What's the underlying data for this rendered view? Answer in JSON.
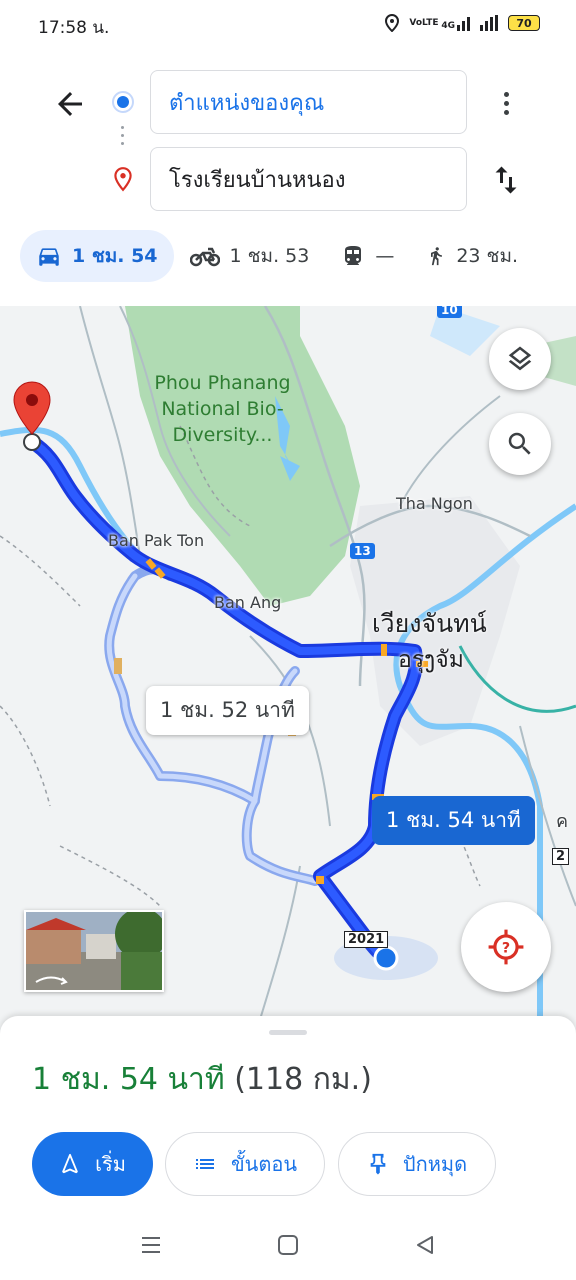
{
  "status_bar": {
    "time": "17:58 น.",
    "network": "4G",
    "volte": "VoLTE",
    "battery": "70"
  },
  "header": {
    "origin": "ตำแหน่งของคุณ",
    "destination": "โรงเรียนบ้านหนอง",
    "icons": {
      "back": "arrow-back-icon",
      "more": "more-vert-icon",
      "swap": "swap-vert-icon"
    }
  },
  "modes": [
    {
      "icon": "car-icon",
      "label": "1 ชม. 54",
      "active": true
    },
    {
      "icon": "motorcycle-icon",
      "label": "1 ชม. 53",
      "active": false
    },
    {
      "icon": "transit-icon",
      "label": "—",
      "active": false
    },
    {
      "icon": "walk-icon",
      "label": "23 ชม.",
      "active": false
    }
  ],
  "map": {
    "labels": {
      "park": "Phou Phanang National Bio-Diversity...",
      "tha_ngon": "Tha Ngon",
      "ban_pak_ton": "Ban Pak Ton",
      "ban_ang": "Ban Ang",
      "city": "เวียงจันทน์",
      "city_sub": "อรุງจัม",
      "route_13": "13",
      "route_2": "2",
      "route_2021": "2021",
      "route_top": "10",
      "edge_char": "ค"
    },
    "alt_route_time": "1 ชม. 52 นาที",
    "main_route_time": "1 ชม. 54 นาที",
    "colors": {
      "route": "#1a4dff",
      "alt_route": "#a8c0f5",
      "park": "#a5d6a7",
      "water": "#7fc8f8"
    }
  },
  "summary": {
    "duration": "1 ชม. 54 นาที",
    "distance": "(118 กม.)"
  },
  "actions": {
    "start": "เริ่ม",
    "steps": "ขั้นตอน",
    "pin": "ปักหมุด"
  }
}
